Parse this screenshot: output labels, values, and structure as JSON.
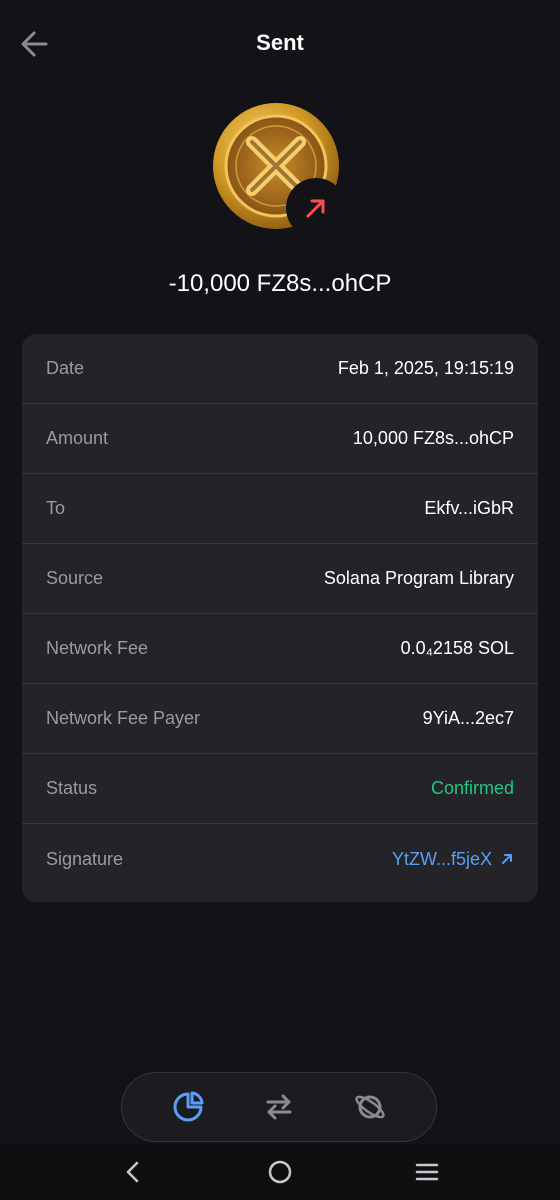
{
  "header": {
    "title": "Sent"
  },
  "coin": {
    "icon": "coin-x-logo",
    "badge_icon": "arrow-up-right-icon",
    "badge_color": "#ff4d4f"
  },
  "summary": {
    "amount": "-10,000 FZ8s...ohCP"
  },
  "details": [
    {
      "label": "Date",
      "value": "Feb 1, 2025, 19:15:19"
    },
    {
      "label": "Amount",
      "value": "10,000 FZ8s...ohCP"
    },
    {
      "label": "To",
      "value": "Ekfv...iGbR"
    },
    {
      "label": "Source",
      "value": "Solana Program Library"
    },
    {
      "label": "Network Fee",
      "value": "0.0₄2158 SOL"
    },
    {
      "label": "Network Fee Payer",
      "value": "9YiA...2ec7"
    },
    {
      "label": "Status",
      "value": "Confirmed",
      "color": "#22c784"
    },
    {
      "label": "Signature",
      "value": "YtZW...f5jeX",
      "color": "#5a9ff5"
    }
  ],
  "bottom_nav": [
    {
      "icon": "portfolio-pie-icon",
      "active": true
    },
    {
      "icon": "swap-arrows-icon",
      "active": false
    },
    {
      "icon": "explore-planet-icon",
      "active": false
    }
  ],
  "system_nav": [
    "back-icon",
    "home-icon",
    "recents-icon"
  ],
  "colors": {
    "background": "#131317",
    "card": "#232328",
    "accent": "#5a9ff5",
    "positive": "#22c784",
    "danger": "#ff4d4f"
  }
}
